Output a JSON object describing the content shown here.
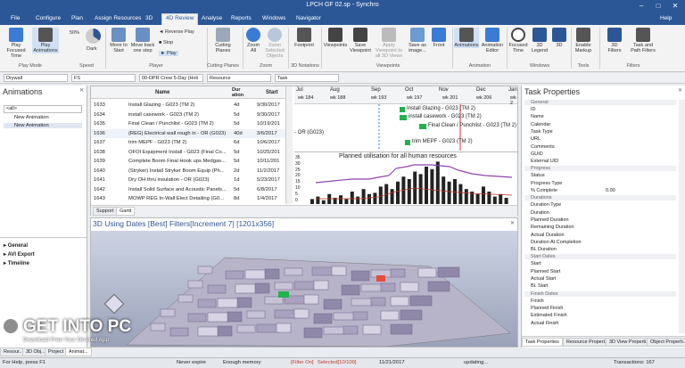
{
  "window": {
    "title": "LPCH GF 02.sp - Synchro",
    "minimize": "–",
    "maximize": "□",
    "close": "✕",
    "help": "Help"
  },
  "menu": {
    "tabs": [
      "File",
      "Configure",
      "Plan",
      "Assign Resources",
      "3D",
      "4D Review",
      "Analyse",
      "Reports",
      "Windows",
      "Navigator"
    ],
    "active": "4D Review"
  },
  "ribbon": {
    "play_focused": "Play Focused Time",
    "play_animations": "Play Animations",
    "speed_value": "50%",
    "dark": "Dark",
    "group_play_mode": "Play Mode",
    "group_speed": "Speed",
    "move_to_start": "Move to Start",
    "move_back": "Move back one step",
    "reverse_play": "Reverse Play",
    "stop": "Stop",
    "play": "Play",
    "group_player": "Player",
    "cutting_planes": "Cutting Planes",
    "group_cutting": "Cutting Planes",
    "zoom_all": "Zoom All",
    "zoom_selected": "Zoom Selected Objects",
    "group_zoom": "Zoom",
    "footprint": "Footprint",
    "group_3d_notations": "3D Notations",
    "viewpoints": "Viewpoints",
    "save_viewpoint": "Save Viewpoint",
    "apply_viewpoint": "Apply Viewpoint to all 3D Views",
    "save_image": "Save as image...",
    "front": "Front",
    "group_viewpoints": "Viewpoints",
    "animations": "Animations",
    "animation_editor": "Animation Editor",
    "group_animation": "Animation",
    "focused_time": "Focused Time",
    "legend": "3D Legend",
    "td": "3D",
    "group_windows": "Windows",
    "enable_markup": "Enable Markup",
    "group_tools": "Tools",
    "filters_3d": "3D Filters",
    "task_filters": "Task and Path Filters",
    "group_filters": "Filters"
  },
  "filterbar": {
    "drywall": "Drywall",
    "fs": "FS",
    "holiday": "00-DPR Crew 5-Day (Holi",
    "resource": "Resource",
    "task": "Task"
  },
  "animations_panel": {
    "title": "Animations",
    "search": "<all>",
    "items": [
      "New Animation",
      "New Animation"
    ],
    "sections": [
      "General",
      "AVI Export",
      "Timeline"
    ]
  },
  "gantt": {
    "headers": {
      "name": "Name",
      "duration": "Dur ation",
      "start": "Start"
    },
    "rows": [
      {
        "id": "1633",
        "name": "Install Glazing - G023 (TM 2)",
        "dur": "4d",
        "start": "9/30/2017"
      },
      {
        "id": "1634",
        "name": "install casework - G023 (TM 2)",
        "dur": "5d",
        "start": "9/30/2017"
      },
      {
        "id": "1635",
        "name": "Final Clean / Punchlist - G023 (TM 2)",
        "dur": "5d",
        "start": "10/19/201"
      },
      {
        "id": "1636",
        "name": "(REG) Electrical wall rough in - OR (G023)",
        "dur": "40d",
        "start": "3/6/2017"
      },
      {
        "id": "1637",
        "name": "trim MEPF - G023 (TM 2)",
        "dur": "6d",
        "start": "10/6/2017"
      },
      {
        "id": "1638",
        "name": "OFOI Equipment Install - G023 (Final Co...",
        "dur": "5d",
        "start": "10/25/201"
      },
      {
        "id": "1639",
        "name": "Complete Boom Final Hook ups Medgas...",
        "dur": "5d",
        "start": "10/11/201"
      },
      {
        "id": "1640",
        "name": "(Stryker) Install Stryker Boom Equip (Ph...",
        "dur": "2d",
        "start": "11/2/2017"
      },
      {
        "id": "1641",
        "name": "Dry OH thru insulation - OR (G023)",
        "dur": "1d",
        "start": "5/23/2017"
      },
      {
        "id": "1642",
        "name": "Install Solid Surface and Acoustic Panels...",
        "dur": "5d",
        "start": "6/8/2017"
      },
      {
        "id": "1643",
        "name": "MOWP REG In-Wall Elect Detailing (G0...",
        "dur": "8d",
        "start": "1/4/2017"
      }
    ],
    "months": [
      "Jul",
      "Aug",
      "Sep",
      "Oct",
      "Nov",
      "Dec",
      "Jan"
    ],
    "weeks": [
      "wk 184",
      "wk 188",
      "wk 193",
      "wk 197",
      "wk 201",
      "wk 206",
      "wk 2"
    ],
    "bar_labels": [
      "Install Glazing - G023 (TM 2)",
      "install casework - G023 (TM 2)",
      "Final Clean / Punchlist - G023 (TM 2)",
      "trim MEPF - G023 (TM 2)"
    ],
    "or_label": "- OR (G023)",
    "tabs": [
      "Support",
      "Gantt"
    ]
  },
  "histogram": {
    "title": "Planned utilisation for all human resources",
    "yticks": [
      "35",
      "30",
      "25",
      "20",
      "15",
      "10",
      "5",
      "0"
    ]
  },
  "view3d": {
    "title": "3D Using Dates [Best] Filters[Increment 7] [1201x356]"
  },
  "task_properties": {
    "title": "Task Properties",
    "categories": [
      {
        "name": "General",
        "props": [
          [
            "ID",
            ""
          ],
          [
            "Name",
            ""
          ],
          [
            "Calendar",
            ""
          ],
          [
            "Task Type",
            ""
          ],
          [
            "URL",
            ""
          ],
          [
            "Comments",
            ""
          ],
          [
            "GUID",
            ""
          ],
          [
            "External UID",
            ""
          ]
        ]
      },
      {
        "name": "Progress",
        "props": [
          [
            "Status",
            ""
          ],
          [
            "Progress Type",
            ""
          ],
          [
            "% Complete",
            "0.00"
          ]
        ]
      },
      {
        "name": "Durations",
        "props": [
          [
            "Duration Type",
            ""
          ],
          [
            "Duration",
            ""
          ],
          [
            "Planned Duration",
            ""
          ],
          [
            "Remaining Duration",
            ""
          ],
          [
            "Actual Duration",
            ""
          ],
          [
            "Duration At Completion",
            ""
          ],
          [
            "BL Duration",
            ""
          ]
        ]
      },
      {
        "name": "Start Dates",
        "props": [
          [
            "Start",
            ""
          ],
          [
            "Planned Start",
            ""
          ],
          [
            "Actual Start",
            ""
          ],
          [
            "BL Start",
            ""
          ]
        ]
      },
      {
        "name": "Finish Dates",
        "props": [
          [
            "Finish",
            ""
          ],
          [
            "Planned Finish",
            ""
          ],
          [
            "Estimated Finish",
            ""
          ],
          [
            "Actual Finish",
            ""
          ]
        ]
      }
    ],
    "tabs": [
      "Task Properties",
      "Resource Propert...",
      "3D View Properti...",
      "Object Properti..."
    ]
  },
  "bottom_tabs": [
    "Resour...",
    "3D Obj...",
    "Project",
    "Animat..."
  ],
  "statusbar": {
    "ready": "For Help, press F1",
    "expiry": "Never expire",
    "memory": "Enough memory",
    "filter": "[Filter On]",
    "selected": "Selected[10/100]",
    "date": "11/21/2017",
    "updating": "updating...",
    "transactions": "Transactions: 167"
  },
  "watermark": {
    "text": "GET INTO PC",
    "sub": "Download Free Your Desired App"
  },
  "colors": {
    "title_blue": "#2b5797",
    "gantt_green": "#22b14c",
    "utilisation_purple": "#8e44ad"
  }
}
